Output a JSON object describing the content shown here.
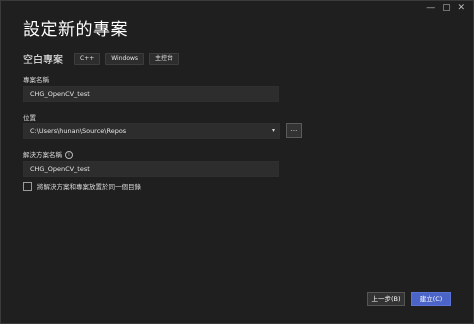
{
  "window": {
    "controls": "— ▢ ✕"
  },
  "title": "設定新的專案",
  "template": {
    "name": "空白專案",
    "tags": [
      "C++",
      "Windows",
      "主控台"
    ]
  },
  "fields": {
    "project_name_label": "專案名稱",
    "project_name_value": "CHG_OpenCV_test",
    "location_label": "位置",
    "location_value": "C:\\Users\\hunan\\Source\\Repos",
    "browse_label": "...",
    "solution_name_label": "解決方案名稱",
    "solution_name_value": "CHG_OpenCV_test"
  },
  "checkbox": {
    "label": "將解決方案和專案放置於同一個目錄",
    "checked": false
  },
  "buttons": {
    "back": "上一步(B)",
    "create": "建立(C)"
  },
  "colors": {
    "background": "#1f1f1f",
    "input_bg": "#2d2d2d",
    "primary_button": "#4a64c8"
  }
}
